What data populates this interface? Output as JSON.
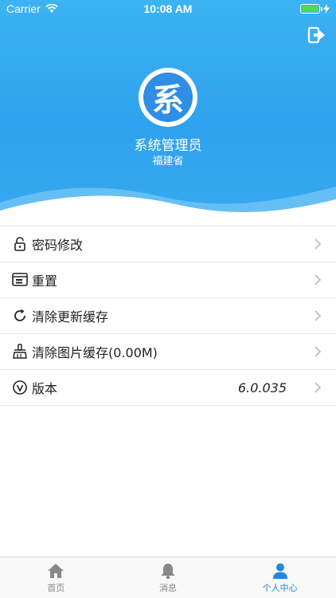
{
  "status_bar": {
    "carrier": "Carrier",
    "time": "10:08 AM"
  },
  "header": {
    "avatar_char": "系",
    "user_name": "系统管理员",
    "region": "福建省"
  },
  "menu": [
    {
      "label": "密码修改",
      "icon": "lock-icon"
    },
    {
      "label": "重置",
      "icon": "reset-icon"
    },
    {
      "label": "清除更新缓存",
      "icon": "refresh-icon"
    },
    {
      "label": "清除图片缓存(0.00M)",
      "icon": "brush-icon"
    },
    {
      "label": "版本",
      "icon": "version-icon",
      "value": "6.0.035"
    }
  ],
  "tabs": [
    {
      "label": "首页",
      "icon": "home-icon",
      "active": false
    },
    {
      "label": "消息",
      "icon": "bell-icon",
      "active": false
    },
    {
      "label": "个人中心",
      "icon": "person-icon",
      "active": true
    }
  ],
  "colors": {
    "header": "#2ea2ee",
    "active_tab": "#1e88e5",
    "inactive_tab": "#888888"
  }
}
